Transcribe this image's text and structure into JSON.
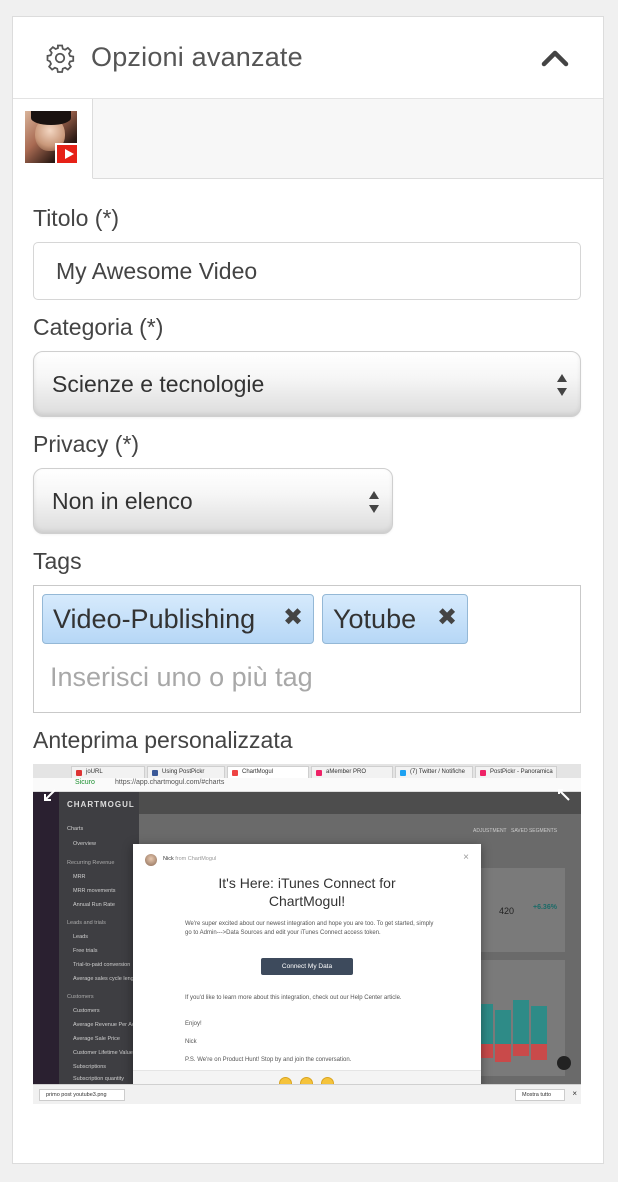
{
  "panel": {
    "title": "Opzioni avanzate",
    "icons": {
      "settings": "gear-icon",
      "collapse": "chevron-up-icon"
    }
  },
  "tabs": [
    {
      "name": "youtube-channel-tab",
      "icon": "youtube-icon",
      "active": true
    }
  ],
  "form": {
    "title_label": "Titolo (*)",
    "title_value": "My Awesome Video",
    "category_label": "Categoria (*)",
    "category_value": "Scienze e tecnologie",
    "privacy_label": "Privacy (*)",
    "privacy_value": "Non in elenco",
    "tags_label": "Tags",
    "tags": [
      "Video-Publishing",
      "Yotube"
    ],
    "tags_placeholder": "Inserisci uno o più tag",
    "preview_label": "Anteprima personalizzata"
  },
  "preview": {
    "browser_tabs": [
      "joURL",
      "Using PostPickr",
      "ChartMogul",
      "aMember PRO",
      "(7) Twitter / Notifiche",
      "PostPickr - Panoramica"
    ],
    "address_secure": "Sicuro",
    "address_url": "https://app.chartmogul.com/#charts",
    "brand": "CHARTMOGUL",
    "nav": [
      "Charts",
      "Overview",
      "Recurring Revenue",
      "MRR",
      "MRR movements",
      "Annual Run Rate",
      "Leads and trials",
      "Leads",
      "Free trials",
      "Trial-to-paid conversion",
      "Average sales cycle leng",
      "Customers",
      "Customers",
      "Average Revenue Per Ac",
      "Average Sale Price",
      "Customer Lifetime Value",
      "Subscriptions",
      "Subscription quantity"
    ],
    "topbar_buttons": [
      "ADJUSTMENT",
      "SAVED SEGMENTS"
    ],
    "stat_value": "420",
    "stat_change": "+6.36%",
    "modal": {
      "from_name": "Nick",
      "from_sub": "from ChartMogul",
      "title_line1": "It's Here: iTunes Connect for",
      "title_line2": "ChartMogul!",
      "para1": "We're super excited about our newest integration and hope you are too. To get started, simply go to Admin--->Data Sources and edit your iTunes Connect access token.",
      "button": "Connect My Data",
      "para2": "If you'd like to learn more about this integration, check out our Help Center article.",
      "enjoy": "Enjoy!",
      "sign": "Nick",
      "ps": "P.S. We're on Product Hunt! Stop by and join the conversation."
    },
    "download_file": "primo post youtube3.png",
    "download_all": "Mostra tutto"
  },
  "colors": {
    "chip_bg": "#c4e0fa",
    "chip_border": "#94b8d6",
    "youtube_red": "#e62117",
    "chart_teal": "#2e8b87",
    "chart_red": "#c94a4a"
  }
}
